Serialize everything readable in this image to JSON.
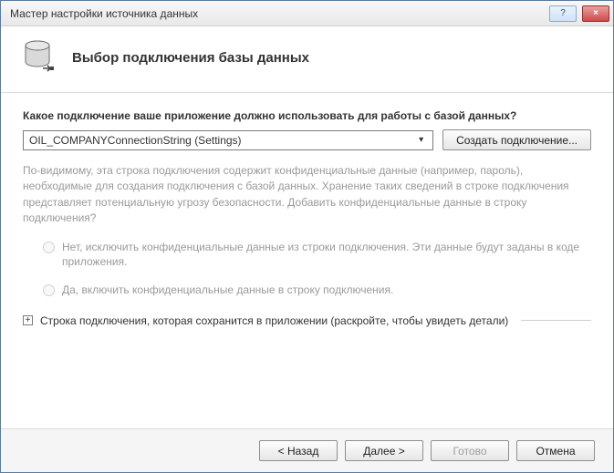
{
  "window": {
    "title": "Мастер настройки источника данных",
    "help": "?",
    "close": "×"
  },
  "header": {
    "title": "Выбор подключения базы данных"
  },
  "content": {
    "question": "Какое подключение ваше приложение должно использовать для работы с базой данных?",
    "selected_connection": "OIL_COMPANYConnectionString (Settings)",
    "new_connection_btn": "Создать подключение...",
    "info_paragraph": "По-видимому, эта строка подключения содержит конфиденциальные данные (например, пароль), необходимые для создания подключения с базой данных. Хранение таких сведений в строке подключения представляет потенциальную угрозу безопасности. Добавить конфиденциальные данные в строку подключения?",
    "radio_no": "Нет, исключить конфиденциальные данные из строки подключения. Эти данные будут заданы в коде приложения.",
    "radio_yes": "Да, включить конфиденциальные данные в строку подключения.",
    "expander_label": "Строка подключения, которая сохранится в приложении (раскройте, чтобы увидеть детали)"
  },
  "footer": {
    "back": "< Назад",
    "next": "Далее >",
    "finish": "Готово",
    "cancel": "Отмена"
  }
}
